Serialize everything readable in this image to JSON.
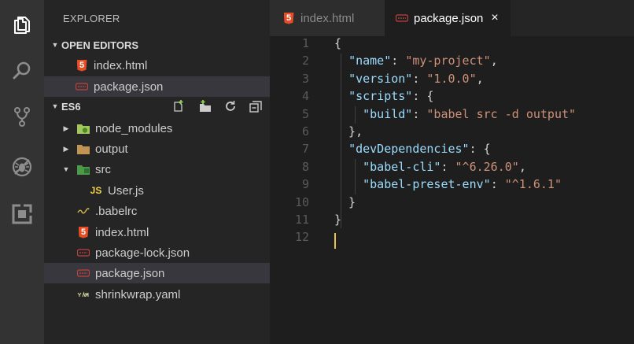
{
  "sidebar": {
    "title": "EXPLORER",
    "open_editors": {
      "label": "OPEN EDITORS",
      "items": [
        {
          "label": "index.html",
          "icon": "html5-icon"
        },
        {
          "label": "package.json",
          "icon": "json-icon"
        }
      ]
    },
    "project": {
      "label": "ES6",
      "tools": [
        "new-file-icon",
        "new-folder-icon",
        "refresh-icon",
        "collapse-all-icon"
      ],
      "items": [
        {
          "label": "node_modules",
          "icon": "folder-node-icon"
        },
        {
          "label": "output",
          "icon": "folder-icon"
        },
        {
          "label": "src",
          "icon": "folder-src-icon"
        },
        {
          "label": "User.js",
          "icon": "js-icon"
        },
        {
          "label": ".babelrc",
          "icon": "babel-icon"
        },
        {
          "label": "index.html",
          "icon": "html5-icon"
        },
        {
          "label": "package-lock.json",
          "icon": "json-icon"
        },
        {
          "label": "package.json",
          "icon": "json-icon"
        },
        {
          "label": "shrinkwrap.yaml",
          "icon": "yaml-icon"
        }
      ]
    }
  },
  "tabs": [
    {
      "label": "index.html",
      "active": false
    },
    {
      "label": "package.json",
      "active": true,
      "close": "×"
    }
  ],
  "editor": {
    "line_numbers": [
      "1",
      "2",
      "3",
      "4",
      "5",
      "6",
      "7",
      "8",
      "9",
      "10",
      "11",
      "12"
    ],
    "lines": [
      [
        {
          "t": "{",
          "c": "p"
        }
      ],
      [
        {
          "t": "  ",
          "c": "p"
        },
        {
          "t": "\"name\"",
          "c": "k"
        },
        {
          "t": ": ",
          "c": "p"
        },
        {
          "t": "\"my-project\"",
          "c": "s"
        },
        {
          "t": ",",
          "c": "p"
        }
      ],
      [
        {
          "t": "  ",
          "c": "p"
        },
        {
          "t": "\"version\"",
          "c": "k"
        },
        {
          "t": ": ",
          "c": "p"
        },
        {
          "t": "\"1.0.0\"",
          "c": "s"
        },
        {
          "t": ",",
          "c": "p"
        }
      ],
      [
        {
          "t": "  ",
          "c": "p"
        },
        {
          "t": "\"scripts\"",
          "c": "k"
        },
        {
          "t": ": {",
          "c": "p"
        }
      ],
      [
        {
          "t": "    ",
          "c": "p"
        },
        {
          "t": "\"build\"",
          "c": "k"
        },
        {
          "t": ": ",
          "c": "p"
        },
        {
          "t": "\"babel src -d output\"",
          "c": "s"
        }
      ],
      [
        {
          "t": "  },",
          "c": "p"
        }
      ],
      [
        {
          "t": "  ",
          "c": "p"
        },
        {
          "t": "\"devDependencies\"",
          "c": "k"
        },
        {
          "t": ": {",
          "c": "p"
        }
      ],
      [
        {
          "t": "    ",
          "c": "p"
        },
        {
          "t": "\"babel-cli\"",
          "c": "k"
        },
        {
          "t": ": ",
          "c": "p"
        },
        {
          "t": "\"^6.26.0\"",
          "c": "s"
        },
        {
          "t": ",",
          "c": "p"
        }
      ],
      [
        {
          "t": "    ",
          "c": "p"
        },
        {
          "t": "\"babel-preset-env\"",
          "c": "k"
        },
        {
          "t": ": ",
          "c": "p"
        },
        {
          "t": "\"^1.6.1\"",
          "c": "s"
        }
      ],
      [
        {
          "t": "  }",
          "c": "p"
        }
      ],
      [
        {
          "t": "}",
          "c": "p"
        }
      ],
      []
    ]
  },
  "colors": {
    "activity_bar": "#333333",
    "sidebar": "#252526",
    "editor": "#1e1e1e",
    "json_key": "#9cdcfe",
    "json_string": "#ce9178",
    "cursor": "#e8c34a",
    "html_icon": "#e44d26"
  }
}
